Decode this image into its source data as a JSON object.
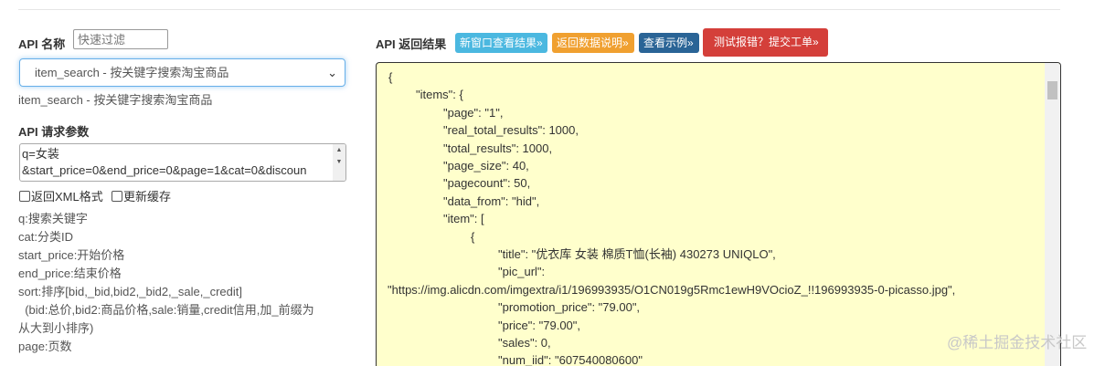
{
  "left": {
    "api_name_label": "API 名称",
    "filter_placeholder": "快速过滤",
    "selected_api": "item_search - 按关键字搜索淘宝商品",
    "selected_api_desc": "item_search - 按关键字搜索淘宝商品",
    "params_label": "API 请求参数",
    "params_lines": [
      "q=女装",
      "&start_price=0&end_price=0&page=1&cat=0&discoun"
    ],
    "checkbox_xml": "返回XML格式",
    "checkbox_cache": "更新缓存",
    "help_lines": [
      "q:搜索关键字",
      "cat:分类ID",
      "start_price:开始价格",
      "end_price:结束价格",
      "sort:排序[bid,_bid,bid2,_bid2,_sale,_credit]",
      "  (bid:总价,bid2:商品价格,sale:销量,credit信用,加_前缀为",
      "从大到小排序)",
      "page:页数"
    ]
  },
  "right": {
    "result_label": "API 返回结果",
    "buttons": [
      {
        "label": "新窗口查看结果»",
        "color": "#4bb8e0"
      },
      {
        "label": "返回数据说明»",
        "color": "#f0a030"
      },
      {
        "label": "查看示例»",
        "color": "#2a6496"
      },
      {
        "label": "测试报错？提交工单»",
        "color": "#d43f3a"
      }
    ],
    "json_lines": [
      "{",
      "\"items\": {",
      "\"page\": \"1\",",
      "\"real_total_results\": 1000,",
      "\"total_results\": 1000,",
      "\"page_size\": 40,",
      "\"pagecount\": 50,",
      "\"data_from\": \"hid\",",
      "\"item\": [",
      "{",
      "\"title\": \"优衣库 女装 棉质T恤(长袖) 430273 UNIQLO\",",
      "\"pic_url\":",
      "\"https://img.alicdn.com/imgextra/i1/196993935/O1CN019g5Rmc1ewH9VOcioZ_!!196993935-0-picasso.jpg\",",
      "\"promotion_price\": \"79.00\",",
      "\"price\": \"79.00\",",
      "\"sales\": 0,",
      "\"num_iid\": \"607540080600\""
    ]
  },
  "watermark": "@稀土掘金技术社区"
}
